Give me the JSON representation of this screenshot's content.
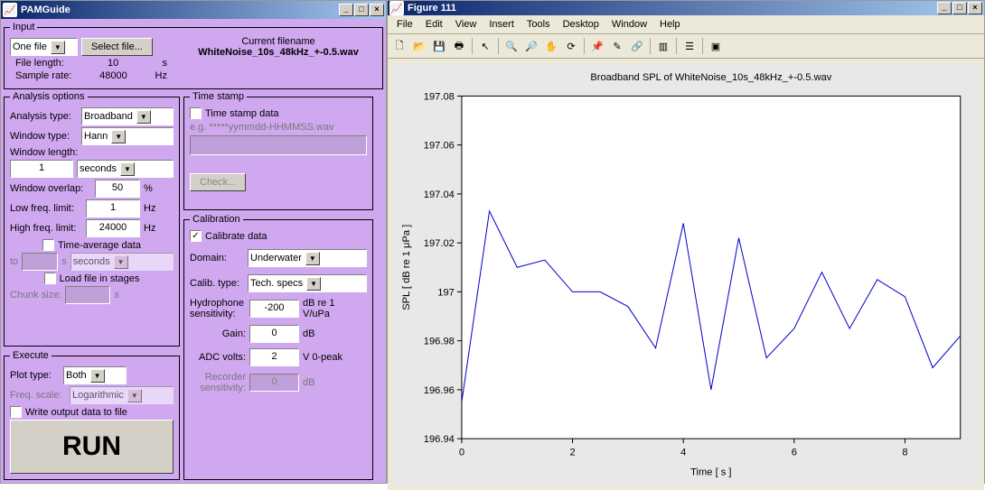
{
  "pam": {
    "title": "PAMGuide",
    "input": {
      "legend": "Input",
      "source": "One file",
      "select_file_btn": "Select file...",
      "current_filename_label": "Current filename",
      "current_filename": "WhiteNoise_10s_48kHz_+-0.5.wav",
      "file_length_label": "File length:",
      "file_length_value": "10",
      "file_length_unit": "s",
      "sample_rate_label": "Sample rate:",
      "sample_rate_value": "48000",
      "sample_rate_unit": "Hz"
    },
    "analysis": {
      "legend": "Analysis options",
      "analysis_type_label": "Analysis type:",
      "analysis_type": "Broadband",
      "window_type_label": "Window type:",
      "window_type": "Hann",
      "window_length_label": "Window length:",
      "window_length": "1",
      "window_length_unit": "seconds",
      "window_overlap_label": "Window overlap:",
      "window_overlap": "50",
      "window_overlap_unit": "%",
      "low_freq_label": "Low freq. limit:",
      "low_freq": "1",
      "low_freq_unit": "Hz",
      "high_freq_label": "High freq. limit:",
      "high_freq": "24000",
      "high_freq_unit": "Hz",
      "time_avg_label": "Time-average data",
      "to_label": "to",
      "s_unit": "s",
      "seconds_unit": "seconds",
      "load_stages_label": "Load file in stages",
      "chunk_size_label": "Chunk size:"
    },
    "execute": {
      "legend": "Execute",
      "plot_type_label": "Plot type:",
      "plot_type": "Both",
      "freq_scale_label": "Freq. scale:",
      "freq_scale": "Logarithmic",
      "write_output_label": "Write output data to file",
      "run_btn": "RUN"
    },
    "timestamp": {
      "legend": "Time stamp",
      "checkbox_label": "Time stamp data",
      "placeholder": "e.g. *****yymmdd-HHMMSS.wav",
      "check_btn": "Check..."
    },
    "calibration": {
      "legend": "Calibration",
      "calibrate_label": "Calibrate data",
      "domain_label": "Domain:",
      "domain": "Underwater",
      "calib_type_label": "Calib. type:",
      "calib_type": "Tech. specs",
      "hydro_label": "Hydrophone sensitivity:",
      "hydro_value": "-200",
      "hydro_unit": "dB re 1 V/uPa",
      "gain_label": "Gain:",
      "gain_value": "0",
      "gain_unit": "dB",
      "adc_label": "ADC volts:",
      "adc_value": "2",
      "adc_unit": "V 0-peak",
      "recorder_label": "Recorder sensitivity:",
      "recorder_value": "0",
      "recorder_unit": "dB"
    }
  },
  "figure": {
    "title": "Figure 111",
    "menus": [
      "File",
      "Edit",
      "View",
      "Insert",
      "Tools",
      "Desktop",
      "Window",
      "Help"
    ],
    "toolbar_icons": [
      "new-icon",
      "open-icon",
      "save-icon",
      "print-icon",
      "sep",
      "arrow-icon",
      "sep",
      "zoom-in-icon",
      "zoom-out-icon",
      "pan-icon",
      "rotate-icon",
      "sep",
      "datacursor-icon",
      "brush-icon",
      "link-icon",
      "sep",
      "colorbar-icon",
      "sep",
      "legend-icon",
      "sep",
      "dock-icon"
    ],
    "chart_title": "Broadband SPL of WhiteNoise_10s_48kHz_+-0.5.wav",
    "xlabel": "Time [ s ]",
    "ylabel": "SPL [ dB re 1 μPa ]"
  },
  "chart_data": {
    "type": "line",
    "title": "Broadband SPL of WhiteNoise_10s_48kHz_+-0.5.wav",
    "xlabel": "Time [ s ]",
    "ylabel": "SPL [ dB re 1 μPa ]",
    "xlim": [
      0,
      9
    ],
    "ylim": [
      196.94,
      197.08
    ],
    "xticks": [
      0,
      2,
      4,
      6,
      8
    ],
    "yticks": [
      196.94,
      196.96,
      196.98,
      197,
      197.02,
      197.04,
      197.06,
      197.08
    ],
    "x": [
      0.0,
      0.5,
      1.0,
      1.5,
      2.0,
      2.5,
      3.0,
      3.5,
      4.0,
      4.5,
      5.0,
      5.5,
      6.0,
      6.5,
      7.0,
      7.5,
      8.0,
      8.5,
      9.0
    ],
    "y": [
      196.955,
      197.033,
      197.01,
      197.013,
      197.0,
      197.0,
      196.994,
      196.977,
      197.028,
      196.96,
      197.022,
      196.973,
      196.985,
      197.008,
      196.985,
      197.005,
      196.998,
      196.969,
      196.982
    ]
  }
}
